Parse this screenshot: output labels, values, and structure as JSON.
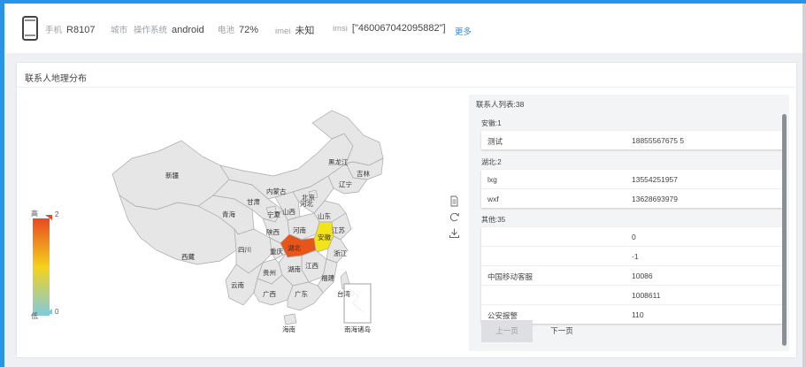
{
  "device": {
    "model_label": "手机",
    "model_value": "R8107",
    "city_label": "城市",
    "os_label": "操作系统",
    "os_value": "android",
    "battery_label": "电池",
    "battery_value": "72%",
    "imei_label": "imei",
    "imei_value": "未知",
    "imsi_label": "imsi",
    "imsi_value": "[\"460067042095882\"]",
    "more_label": "更多"
  },
  "panel": {
    "title": "联系人地理分布"
  },
  "visual_map": {
    "high_label": "高",
    "low_label": "低",
    "max": "2",
    "min": "0",
    "colors": [
      "#e84a1f",
      "#f5d21c",
      "#7ecbe0"
    ]
  },
  "map": {
    "province_labels": [
      "新疆",
      "西藏",
      "青海",
      "甘肃",
      "宁夏",
      "内蒙古",
      "黑龙江",
      "吉林",
      "辽宁",
      "北京",
      "河北",
      "山西",
      "山东",
      "河南",
      "陕西",
      "四川",
      "重庆",
      "湖北",
      "安徽",
      "江苏",
      "浙江",
      "湖南",
      "贵州",
      "云南",
      "广西",
      "广东",
      "福建",
      "江西",
      "海南",
      "台湾",
      "南海诸岛"
    ],
    "highlight": {
      "hubei": "#e8551b",
      "anhui": "#f2e31b"
    },
    "base_fill": "#e6e6e6",
    "border_color": "#a9a9a9"
  },
  "contacts": {
    "title": "联系人列表:38",
    "groups": [
      {
        "label": "安徽:1",
        "rows": [
          {
            "name": "测试",
            "phone": "18855567675 5"
          }
        ]
      },
      {
        "label": "湖北:2",
        "rows": [
          {
            "name": "lxg",
            "phone": "13554251957"
          },
          {
            "name": "wxf",
            "phone": "13628693979"
          }
        ]
      },
      {
        "label": "其他:35",
        "rows": [
          {
            "name": "",
            "phone": "0"
          },
          {
            "name": "",
            "phone": "-1"
          },
          {
            "name": "中国移动客服",
            "phone": "10086"
          },
          {
            "name": "",
            "phone": "1008611"
          },
          {
            "name": "公安报警",
            "phone": "110"
          }
        ]
      }
    ],
    "prev_label": "上一页",
    "next_label": "下一页"
  }
}
